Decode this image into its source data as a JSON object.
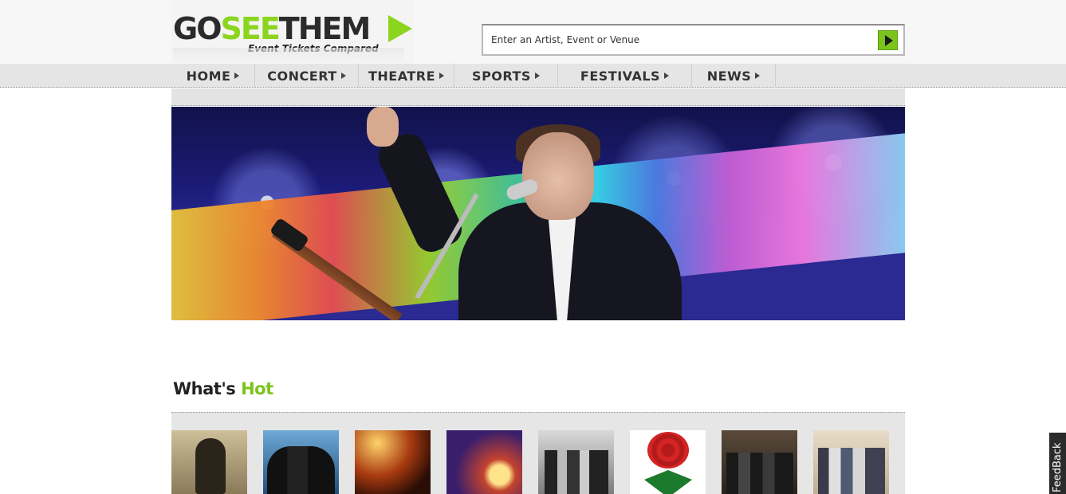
{
  "brand": {
    "logo_part1": "GO",
    "logo_part2": "SEE",
    "logo_part3": "THEM",
    "tagline": "Event Tickets Compared"
  },
  "search": {
    "placeholder": "Enter an Artist, Event or Venue"
  },
  "nav": {
    "items": [
      {
        "label": "HOME"
      },
      {
        "label": "CONCERT"
      },
      {
        "label": "THEATRE"
      },
      {
        "label": "SPORTS"
      },
      {
        "label": "FESTIVALS"
      },
      {
        "label": "NEWS"
      }
    ]
  },
  "whats_hot": {
    "title_part1": "What's",
    "title_part2": "Hot"
  },
  "feedback": {
    "label": "FeedBack"
  },
  "colors": {
    "accent": "#7cc41b",
    "dark": "#2b2b2b",
    "nav_bg": "#e5e5e5"
  }
}
